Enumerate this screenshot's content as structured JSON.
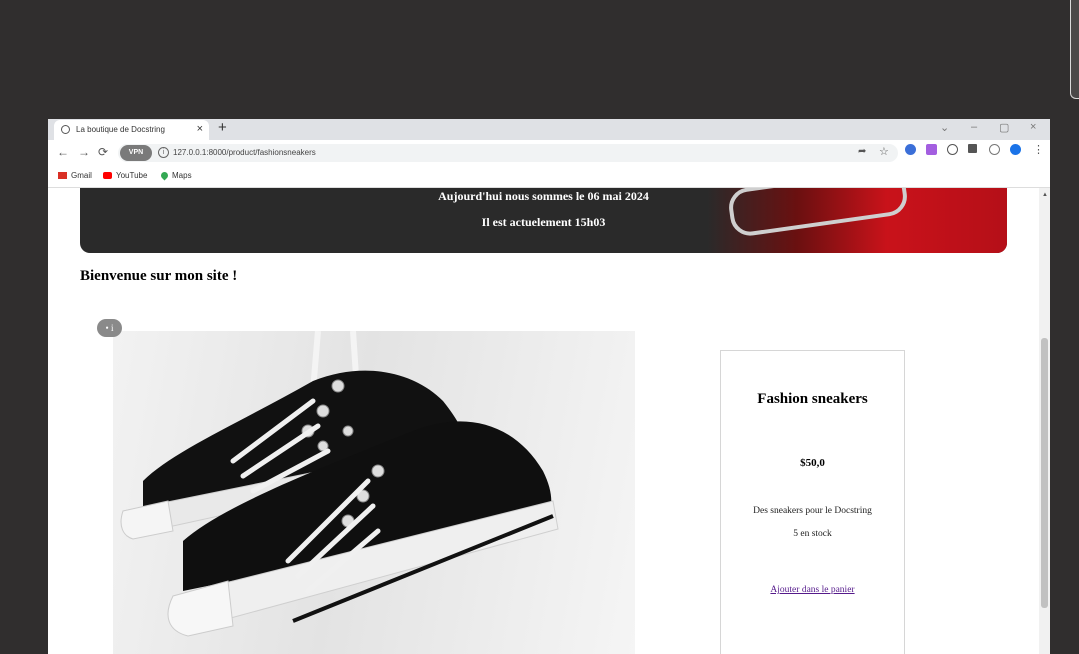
{
  "browser": {
    "tab_title": "La boutique de Docstring",
    "tab_close": "×",
    "new_tab": "+",
    "url": "127.0.0.1:8000/product/fashionsneakers",
    "vpn_label": "VPN",
    "window_controls": {
      "chevron": "⌄",
      "minimize": "–",
      "restore": "▢",
      "close": "×"
    },
    "nav": {
      "back": "←",
      "forward": "→",
      "reload": "⟳"
    },
    "bookmarks": [
      {
        "label": "Gmail",
        "icon": "gmail-icon",
        "color": "#d93025"
      },
      {
        "label": "YouTube",
        "icon": "youtube-icon",
        "color": "#ff0000"
      },
      {
        "label": "Maps",
        "icon": "maps-icon",
        "color": "#34a853"
      }
    ]
  },
  "banner": {
    "date_line": "Aujourd'hui nous sommes le 06 mai 2024",
    "time_line": "Il est actuelement 15h03"
  },
  "page": {
    "welcome": "Bienvenue sur mon site !"
  },
  "product": {
    "name": "Fashion sneakers",
    "price": "$50,0",
    "description": "Des sneakers pour le Docstring",
    "stock": "5 en stock",
    "add_to_cart": "Ajouter dans le panier"
  },
  "colors": {
    "desktop": "#302e2e",
    "banner_red": "#c9121a",
    "link": "#551a8b"
  }
}
